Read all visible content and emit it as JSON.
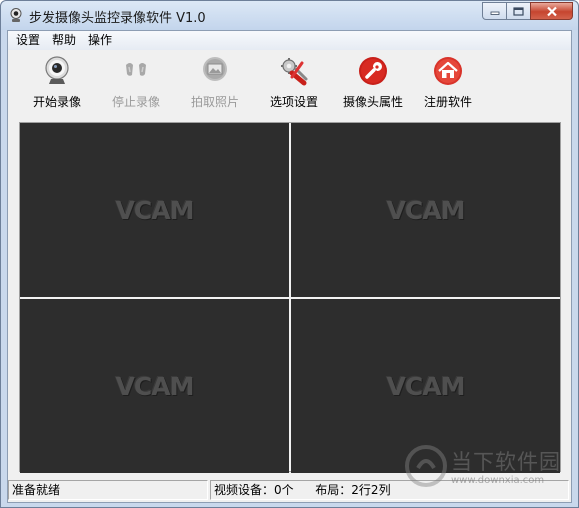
{
  "window": {
    "title": "步发摄像头监控录像软件 V1.0"
  },
  "menu": [
    "设置",
    "帮助",
    "操作"
  ],
  "toolbar": {
    "buttons": [
      {
        "label": "开始录像",
        "icon": "webcam-icon",
        "enabled": true
      },
      {
        "label": "停止录像",
        "icon": "stop-record-icon",
        "enabled": false
      },
      {
        "label": "拍取照片",
        "icon": "photo-icon",
        "enabled": false
      },
      {
        "label": "选项设置",
        "icon": "settings-tools-icon",
        "enabled": true
      },
      {
        "label": "摄像头属性",
        "icon": "wrench-icon",
        "enabled": true
      },
      {
        "label": "注册软件",
        "icon": "home-icon",
        "enabled": true
      }
    ]
  },
  "video_tiles": [
    "VCAM",
    "VCAM",
    "VCAM",
    "VCAM"
  ],
  "status": {
    "ready": "准备就绪",
    "devices": "视频设备：0个",
    "layout": "布局：2行2列"
  },
  "watermark": {
    "title": "当下软件园",
    "url": "www.downxia.com"
  },
  "colors": {
    "tile_bg": "#2d2d2d",
    "accent_red": "#c8201a",
    "title_gradient": "#c3d5ec"
  }
}
